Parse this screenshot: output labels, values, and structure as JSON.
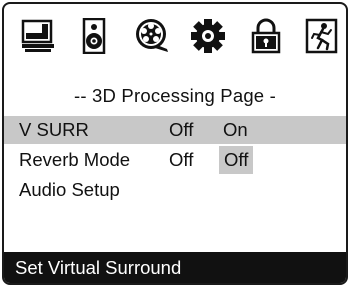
{
  "icons": [
    {
      "name": "tv-icon"
    },
    {
      "name": "speaker-icon"
    },
    {
      "name": "film-reel-icon"
    },
    {
      "name": "gear-icon"
    },
    {
      "name": "lock-icon"
    },
    {
      "name": "exit-icon"
    }
  ],
  "page_title": "-- 3D Processing Page -",
  "rows": [
    {
      "label": "V SURR",
      "value": "Off",
      "option": "On"
    },
    {
      "label": "Reverb Mode",
      "value": "Off",
      "option": "Off"
    },
    {
      "label": "Audio Setup"
    }
  ],
  "status_text": "Set Virtual Surround",
  "colors": {
    "highlight": "#c8c8c8",
    "status_bar": "#111111",
    "border": "#1a1a1a"
  }
}
